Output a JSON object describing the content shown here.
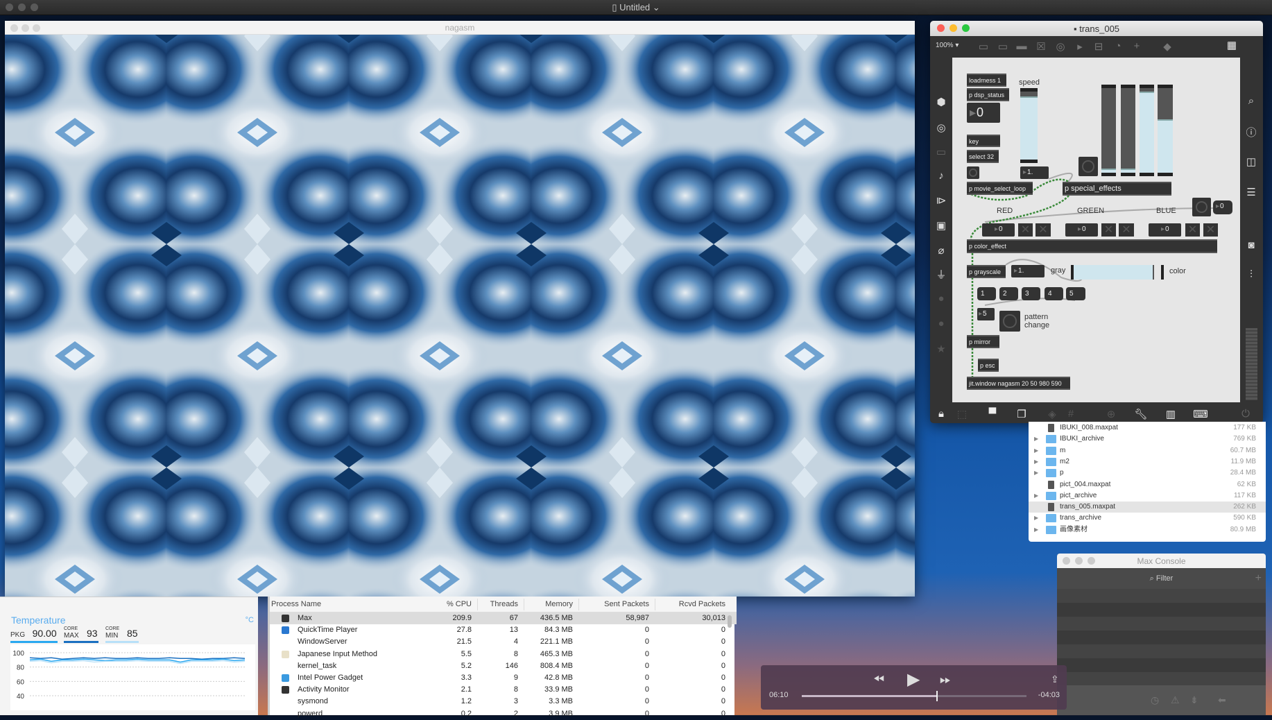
{
  "menubar": {
    "title": "Untitled"
  },
  "nagasm": {
    "title": "nagasm"
  },
  "trans": {
    "title": "trans_005",
    "zoom": "100%",
    "objects": {
      "loadmess": "loadmess 1",
      "dsp": "p dsp_status",
      "num0": "0",
      "key": "key",
      "select": "select 32",
      "movie": "p movie_select_loop",
      "speed_label": "speed",
      "speed_num": "1.",
      "special": "p special_effects",
      "red": "RED",
      "green": "GREEN",
      "blue": "BLUE",
      "red_num": "0",
      "green_num": "0",
      "blue_num": "0",
      "fx_num": "0",
      "color_effect": "p color_effect",
      "grayscale": "p grayscale",
      "gray_num": "1.",
      "gray_label": "gray",
      "color_label": "color",
      "msgs": [
        "1",
        "2",
        "3",
        "4",
        "5"
      ],
      "pattern_num": "5",
      "pattern_label": "pattern change",
      "mirror": "p mirror",
      "esc": "p esc",
      "jitwindow": "jit.window nagasm 20 50 980 590"
    },
    "speed_level": 0.93,
    "effect_sliders": [
      0.05,
      0.05,
      0.96,
      0.63
    ],
    "gray_color_level": 0.92
  },
  "finder": {
    "rows": [
      {
        "name": "IBUKI_008.maxpat",
        "size": "177 KB",
        "type": "file"
      },
      {
        "name": "IBUKI_archive",
        "size": "769 KB",
        "type": "folder"
      },
      {
        "name": "m",
        "size": "60.7 MB",
        "type": "folder"
      },
      {
        "name": "m2",
        "size": "11.9 MB",
        "type": "folder"
      },
      {
        "name": "p",
        "size": "28.4 MB",
        "type": "folder"
      },
      {
        "name": "pict_004.maxpat",
        "size": "62 KB",
        "type": "file"
      },
      {
        "name": "pict_archive",
        "size": "117 KB",
        "type": "folder"
      },
      {
        "name": "trans_005.maxpat",
        "size": "262 KB",
        "type": "file",
        "selected": true
      },
      {
        "name": "trans_archive",
        "size": "590 KB",
        "type": "folder"
      },
      {
        "name": "画像素材",
        "size": "80.9 MB",
        "type": "folder"
      }
    ]
  },
  "console": {
    "title": "Max Console",
    "filter": "Filter"
  },
  "player": {
    "elapsed": "06:10",
    "remaining": "-04:03",
    "progress": 0.6
  },
  "temperature": {
    "title": "Temperature",
    "unit": "°C",
    "pkg_label": "PKG",
    "pkg_value": "90.00",
    "core": "CORE",
    "max_label": "MAX",
    "max_value": "93",
    "min_label": "MIN",
    "min_value": "85",
    "colors": {
      "pkg": "#2aa8f0",
      "max": "#1a6fc0",
      "min": "#b8e0f8"
    },
    "chart_data": {
      "type": "line",
      "yticks": [
        "100",
        "80",
        "60",
        "40"
      ],
      "ylim": [
        40,
        100
      ],
      "series": [
        {
          "values": [
            93,
            92,
            93,
            91,
            92,
            93,
            92,
            93,
            92,
            92,
            93,
            92,
            92,
            93,
            92,
            92,
            91,
            92,
            92,
            93,
            92
          ]
        },
        {
          "values": [
            90,
            91,
            88,
            90,
            90,
            91,
            90,
            89,
            90,
            90,
            91,
            90,
            90,
            90,
            87,
            90,
            90,
            90,
            91,
            89,
            90
          ]
        },
        {
          "values": [
            88,
            89,
            86,
            88,
            88,
            89,
            87,
            88,
            88,
            88,
            89,
            88,
            88,
            88,
            85,
            88,
            88,
            88,
            89,
            87,
            88
          ]
        }
      ]
    }
  },
  "activity": {
    "columns": [
      "Process Name",
      "% CPU",
      "Threads",
      "Memory",
      "Sent Packets",
      "Rcvd Packets"
    ],
    "rows": [
      [
        "Max",
        "209.9",
        "67",
        "436.5 MB",
        "58,987",
        "30,013"
      ],
      [
        "QuickTime Player",
        "27.8",
        "13",
        "84.3 MB",
        "0",
        "0"
      ],
      [
        "WindowServer",
        "21.5",
        "4",
        "221.1 MB",
        "0",
        "0"
      ],
      [
        "Japanese Input Method",
        "5.5",
        "8",
        "465.3 MB",
        "0",
        "0"
      ],
      [
        "kernel_task",
        "5.2",
        "146",
        "808.4 MB",
        "0",
        "0"
      ],
      [
        "Intel Power Gadget",
        "3.3",
        "9",
        "42.8 MB",
        "0",
        "0"
      ],
      [
        "Activity Monitor",
        "2.1",
        "8",
        "33.9 MB",
        "0",
        "0"
      ],
      [
        "sysmond",
        "1.2",
        "3",
        "3.3 MB",
        "0",
        "0"
      ],
      [
        "powerd",
        "0.2",
        "2",
        "3.9 MB",
        "0",
        "0"
      ]
    ],
    "icons": [
      "max-icon",
      "quicktime-icon",
      "",
      "japanese-input-icon",
      "",
      "power-gadget-icon",
      "activity-monitor-icon",
      "",
      ""
    ]
  }
}
